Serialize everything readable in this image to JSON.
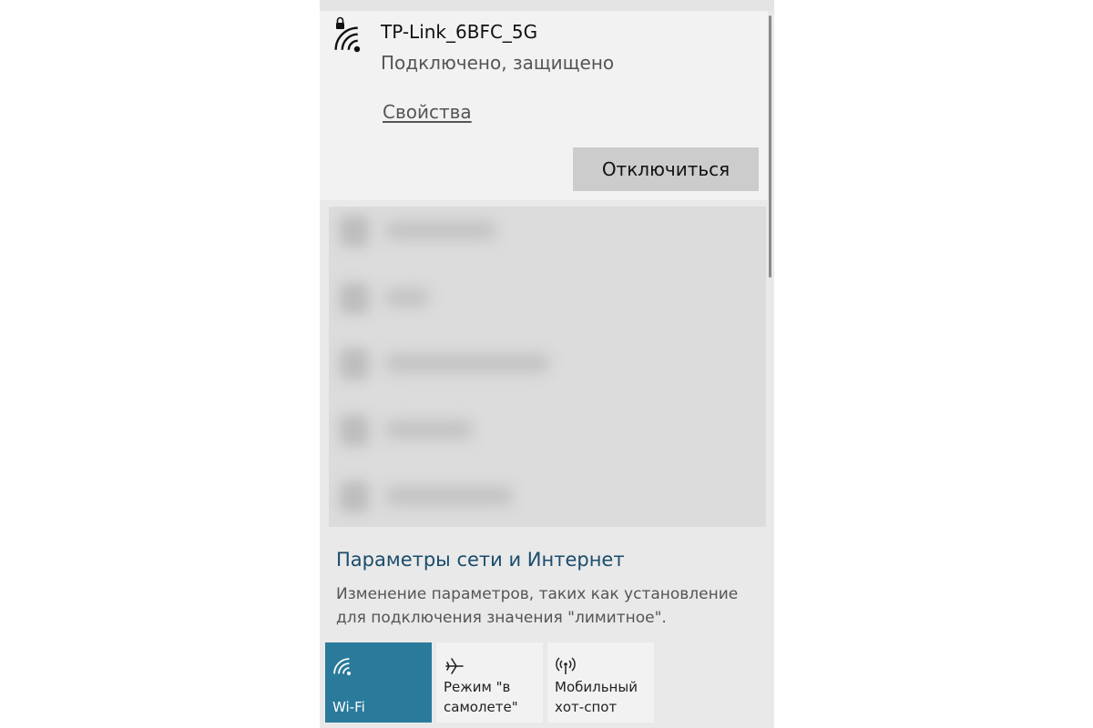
{
  "connected_network": {
    "name": "TP-Link_6BFC_5G",
    "status": "Подключено, защищено",
    "properties_link": "Свойства",
    "disconnect_button": "Отключиться",
    "icon": "wifi-lock-icon"
  },
  "settings_link": {
    "title": "Параметры сети и Интернет",
    "description": "Изменение параметров, таких как установление для подключения значения \"лимитное\"."
  },
  "quick_actions": [
    {
      "label": "Wi-Fi",
      "icon": "wifi-icon",
      "active": true
    },
    {
      "label": "Режим \"в самолете\"",
      "icon": "airplane-icon",
      "active": false
    },
    {
      "label": "Мобильный хот-спот",
      "icon": "hotspot-icon",
      "active": false
    }
  ],
  "colors": {
    "accent": "#2a7a9b",
    "link_title": "#1a4c6b",
    "panel_bg": "#e9e9e9",
    "card_bg": "#f2f2f2"
  }
}
